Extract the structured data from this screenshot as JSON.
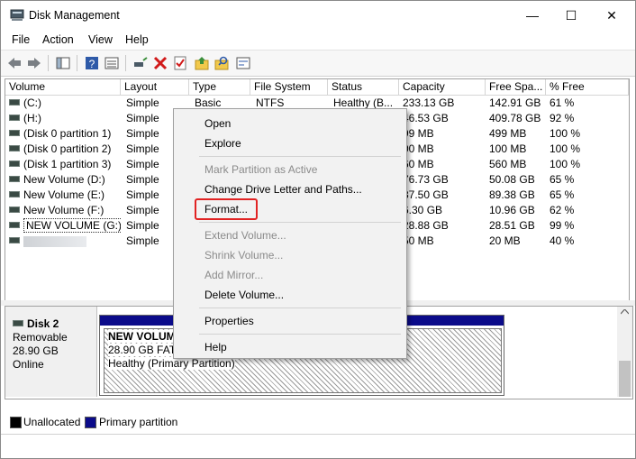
{
  "window": {
    "title": "Disk Management",
    "minimize": "—",
    "maximize": "☐",
    "close": "✕"
  },
  "menu": [
    "File",
    "Action",
    "View",
    "Help"
  ],
  "columns": [
    "Volume",
    "Layout",
    "Type",
    "File System",
    "Status",
    "Capacity",
    "Free Spa...",
    "% Free"
  ],
  "volumes": [
    {
      "volume": "(C:)",
      "layout": "Simple",
      "type": "Basic",
      "fs": "NTFS",
      "status": "Healthy (B...",
      "capacity": "233.13 GB",
      "free": "142.91 GB",
      "pct": "61 %"
    },
    {
      "volume": "(H:)",
      "layout": "Simple",
      "type": "",
      "fs": "",
      "status": "",
      "capacity": "46.53 GB",
      "free": "409.78 GB",
      "pct": "92 %"
    },
    {
      "volume": "(Disk 0 partition 1)",
      "layout": "Simple",
      "type": "",
      "fs": "",
      "status": "",
      "capacity": "99 MB",
      "free": "499 MB",
      "pct": "100 %"
    },
    {
      "volume": "(Disk 0 partition 2)",
      "layout": "Simple",
      "type": "",
      "fs": "",
      "status": "",
      "capacity": "00 MB",
      "free": "100 MB",
      "pct": "100 %"
    },
    {
      "volume": "(Disk 1 partition 3)",
      "layout": "Simple",
      "type": "",
      "fs": "",
      "status": "",
      "capacity": "60 MB",
      "free": "560 MB",
      "pct": "100 %"
    },
    {
      "volume": "New Volume (D:)",
      "layout": "Simple",
      "type": "",
      "fs": "",
      "status": "",
      "capacity": "76.73 GB",
      "free": "50.08 GB",
      "pct": "65 %"
    },
    {
      "volume": "New Volume (E:)",
      "layout": "Simple",
      "type": "",
      "fs": "",
      "status": "",
      "capacity": "37.50 GB",
      "free": "89.38 GB",
      "pct": "65 %"
    },
    {
      "volume": "New Volume (F:)",
      "layout": "Simple",
      "type": "",
      "fs": "",
      "status": "",
      "capacity": "6.30 GB",
      "free": "10.96 GB",
      "pct": "62 %"
    },
    {
      "volume": "NEW VOLUME (G:)",
      "layout": "Simple",
      "type": "",
      "fs": "",
      "status": "",
      "capacity": "28.88 GB",
      "free": "28.51 GB",
      "pct": "99 %"
    },
    {
      "volume": "",
      "layout": "Simple",
      "type": "",
      "fs": "",
      "status": "",
      "capacity": "50 MB",
      "free": "20 MB",
      "pct": "40 %"
    }
  ],
  "disk": {
    "name": "Disk 2",
    "kind": "Removable",
    "size": "28.90 GB",
    "state": "Online",
    "partition_name": "NEW VOLUM",
    "partition_size": "28.90 GB FAT3",
    "partition_status": "Healthy (Primary Partition)"
  },
  "legend": [
    {
      "label": "Unallocated",
      "color": "#000000"
    },
    {
      "label": "Primary partition",
      "color": "#0b0b8a"
    }
  ],
  "context_menu": [
    {
      "label": "Open",
      "enabled": true
    },
    {
      "label": "Explore",
      "enabled": true
    },
    {
      "label": "Mark Partition as Active",
      "enabled": false
    },
    {
      "label": "Change Drive Letter and Paths...",
      "enabled": true
    },
    {
      "label": "Format...",
      "enabled": true
    },
    {
      "label": "Extend Volume...",
      "enabled": false
    },
    {
      "label": "Shrink Volume...",
      "enabled": false
    },
    {
      "label": "Add Mirror...",
      "enabled": false
    },
    {
      "label": "Delete Volume...",
      "enabled": true
    },
    {
      "label": "Properties",
      "enabled": true
    },
    {
      "label": "Help",
      "enabled": true
    }
  ],
  "icons": {
    "back": "back-arrow-icon",
    "forward": "forward-arrow-icon",
    "grid": "console-tree-icon",
    "help": "help-icon",
    "list": "list-icon",
    "connect": "connect-icon",
    "delete": "delete-icon",
    "check": "checklist-icon",
    "up": "up-folder-icon",
    "search": "search-icon",
    "props": "properties-icon"
  },
  "colors": {
    "highlight": "#e12323",
    "primary": "#0b0b8a"
  }
}
